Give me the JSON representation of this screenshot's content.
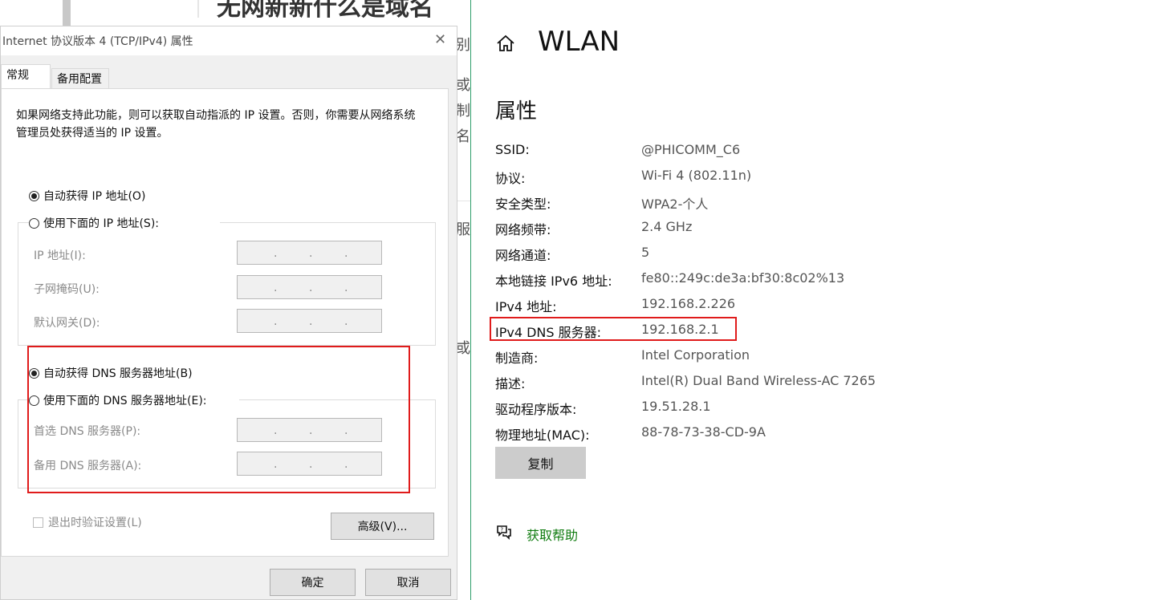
{
  "background": {
    "title": "无网新新什么是域名",
    "chars": [
      "别",
      "或",
      "制",
      "名",
      "服",
      "或"
    ]
  },
  "dialog": {
    "title": "Internet 协议版本 4 (TCP/IPv4) 属性",
    "close_glyph": "✕",
    "tabs": [
      "常规",
      "备用配置"
    ],
    "intro": "如果网络支持此功能，则可以获取自动指派的 IP 设置。否则，你需要从网络系统管理员处获得适当的 IP 设置。",
    "auto_ip_label": "自动获得 IP 地址(O)",
    "manual_ip_label": "使用下面的 IP 地址(S):",
    "ip_address_label": "IP 地址(I):",
    "subnet_label": "子网掩码(U):",
    "gateway_label": "默认网关(D):",
    "auto_dns_label": "自动获得 DNS 服务器地址(B)",
    "manual_dns_label": "使用下面的 DNS 服务器地址(E):",
    "preferred_dns_label": "首选 DNS 服务器(P):",
    "alternate_dns_label": "备用 DNS 服务器(A):",
    "validate_label": "退出时验证设置(L)",
    "advanced_button": "高级(V)...",
    "ok_button": "确定",
    "cancel_button": "取消",
    "ip_dot": "."
  },
  "wlan": {
    "title": "WLAN",
    "section_title": "属性",
    "properties": [
      {
        "label": "SSID:",
        "value": "@PHICOMM_C6"
      },
      {
        "label": "协议:",
        "value": "Wi-Fi 4 (802.11n)"
      },
      {
        "label": "安全类型:",
        "value": "WPA2-个人"
      },
      {
        "label": "网络频带:",
        "value": "2.4 GHz"
      },
      {
        "label": "网络通道:",
        "value": "5"
      },
      {
        "label": "本地链接 IPv6 地址:",
        "value": "fe80::249c:de3a:bf30:8c02%13"
      },
      {
        "label": "IPv4 地址:",
        "value": "192.168.2.226"
      },
      {
        "label": "IPv4 DNS 服务器:",
        "value": "192.168.2.1"
      },
      {
        "label": "制造商:",
        "value": "Intel Corporation"
      },
      {
        "label": "描述:",
        "value": "Intel(R) Dual Band Wireless-AC 7265"
      },
      {
        "label": "驱动程序版本:",
        "value": "19.51.28.1"
      },
      {
        "label": "物理地址(MAC):",
        "value": "88-78-73-38-CD-9A"
      }
    ],
    "copy_button": "复制",
    "help_link": "获取帮助"
  },
  "colors": {
    "highlight_red": "#e01b1b",
    "help_green": "#107c10",
    "divider_green": "#2e9e6a"
  }
}
